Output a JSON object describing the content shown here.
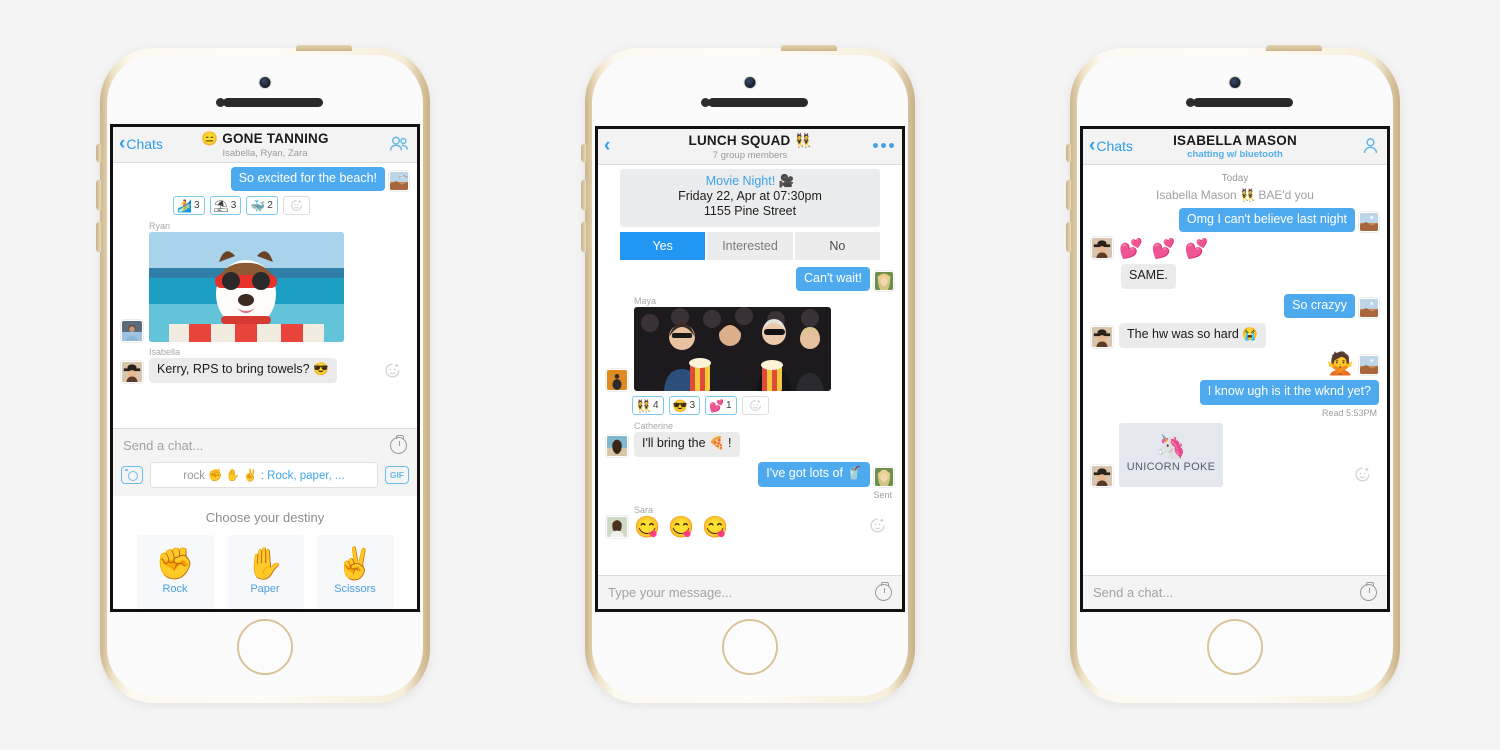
{
  "theme": {
    "accent_blue": "#4eaaee",
    "button_blue": "#2196f3",
    "bubble_grey": "#ebebeb",
    "screen_bg": "#ffffff",
    "chrome_grey": "#f3f3f3"
  },
  "phones": [
    {
      "id": "phone-left",
      "nav": {
        "back_label": "Chats",
        "title": "GONE TANNING",
        "title_emoji": "😑",
        "subtitle": "Isabella, Ryan, Zara",
        "right_icon": "group-people-icon"
      },
      "messages": [
        {
          "kind": "text-me",
          "text": "So excited for the beach!",
          "avatar": "beach-photo-avatar"
        },
        {
          "kind": "reactions",
          "items": [
            {
              "emoji": "🏄",
              "name": "surfer-reaction",
              "count": "3"
            },
            {
              "emoji": "⛱",
              "name": "beach-umbrella-reaction",
              "count": "3"
            },
            {
              "emoji": "🐳",
              "name": "whale-reaction",
              "count": "2"
            }
          ],
          "add_label": "add-reaction"
        },
        {
          "kind": "photo-them",
          "sender": "Ryan",
          "avatar": "ryan-avatar",
          "photo": "dog-in-sunglasses-photo"
        },
        {
          "kind": "text-them",
          "sender": "Isabella",
          "avatar": "isabella-avatar",
          "text": "Kerry, RPS to bring towels? 😎"
        }
      ],
      "composer": {
        "placeholder": "Send a chat...",
        "timer_icon": "timer-icon",
        "camera_icon": "camera-icon",
        "gif_label": "GIF",
        "suggestion_command": "rock ✊ ✋ ✌",
        "suggestion_separator": " : ",
        "suggestion_description": "Rock, paper, ..."
      },
      "destiny": {
        "title": "Choose your destiny",
        "tiles": [
          {
            "emoji": "✊",
            "label": "Rock",
            "name": "rock-tile"
          },
          {
            "emoji": "✋",
            "label": "Paper",
            "name": "paper-tile"
          },
          {
            "emoji": "✌",
            "label": "Scissors",
            "name": "scissors-tile"
          }
        ]
      }
    },
    {
      "id": "phone-center",
      "nav": {
        "back_label": "",
        "title": "LUNCH SQUAD",
        "title_emoji": "👯",
        "subtitle": "7 group members",
        "right_icon": "overflow-dots-icon"
      },
      "event": {
        "title": "Movie Night!",
        "title_emoji": "🎥",
        "datetime": "Friday 22, Apr at 07:30pm",
        "address": "1155 Pine Street",
        "rsvp": [
          {
            "label": "Yes",
            "selected": true
          },
          {
            "label": "Interested",
            "selected": false
          },
          {
            "label": "No",
            "selected": false
          }
        ]
      },
      "messages": [
        {
          "kind": "text-me",
          "text": "Can't wait!",
          "avatar": "blonde-girl-avatar"
        },
        {
          "kind": "photo-them",
          "sender": "Maya",
          "avatar": "maya-avatar",
          "photo": "popcorn-audience-photo"
        },
        {
          "kind": "reactions",
          "items": [
            {
              "emoji": "👯",
              "name": "dancers-reaction",
              "count": "4"
            },
            {
              "emoji": "😎",
              "name": "sunglasses-face-reaction",
              "count": "3"
            },
            {
              "emoji": "💕",
              "name": "two-hearts-reaction",
              "count": "1"
            }
          ],
          "add_label": "add-reaction"
        },
        {
          "kind": "text-them",
          "sender": "Catherine",
          "avatar": "catherine-avatar",
          "text": "I'll bring the 🍕 !"
        },
        {
          "kind": "text-me",
          "text": "I've got lots of 🥤",
          "avatar": "blonde-girl-avatar",
          "status": "Sent"
        },
        {
          "kind": "emoji-them",
          "sender": "Sara",
          "avatar": "sara-avatar",
          "emoji": "😋 😋 😋"
        }
      ],
      "composer": {
        "placeholder": "Type your message...",
        "timer_icon": "timer-icon"
      }
    },
    {
      "id": "phone-right",
      "nav": {
        "back_label": "Chats",
        "title": "ISABELLA MASON",
        "subtitle": "chatting w/ bluetooth",
        "right_icon": "person-icon"
      },
      "date_separator": "Today",
      "system_line": "Isabella Mason 👯 BAE'd you",
      "messages": [
        {
          "kind": "text-me",
          "text": "Omg I can't believe last night",
          "avatar": "beach-photo-avatar"
        },
        {
          "kind": "emoji-them",
          "avatar": "isabella-avatar",
          "emoji": "💕 💕 💕"
        },
        {
          "kind": "text-them",
          "text": "SAME."
        },
        {
          "kind": "text-me",
          "text": "So crazyy",
          "avatar": "beach-photo-avatar"
        },
        {
          "kind": "text-them",
          "avatar": "isabella-avatar",
          "text": "The hw was so hard 😭"
        },
        {
          "kind": "emoji-me",
          "emoji": "🙅",
          "avatar": "beach-photo-avatar"
        },
        {
          "kind": "text-me",
          "text": "I know ugh is it the wknd yet?",
          "status": "Read 5:53PM"
        },
        {
          "kind": "sticker-them",
          "avatar": "isabella-avatar",
          "emoji": "🦄",
          "label": "UNICORN POKE"
        }
      ],
      "composer": {
        "placeholder": "Send a chat...",
        "timer_icon": "timer-icon"
      }
    }
  ]
}
